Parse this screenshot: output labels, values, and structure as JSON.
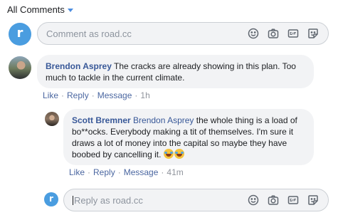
{
  "filter": {
    "label": "All Comments"
  },
  "composer": {
    "placeholder": "Comment as road.cc",
    "avatar_letter": "r"
  },
  "comments": [
    {
      "author": "Brendon Asprey",
      "text": "The cracks are already showing in this plan. Too much to tackle in the current climate.",
      "actions": {
        "like": "Like",
        "reply": "Reply",
        "message": "Message",
        "time": "1h"
      }
    },
    {
      "author": "Scott Bremner",
      "mention": "Brendon Asprey",
      "text": "the whole thing is a load of bo**ocks. Everybody making a tit of themselves. I'm sure it draws a lot of money into the capital so maybe they have boobed by cancelling it.",
      "actions": {
        "like": "Like",
        "reply": "Reply",
        "message": "Message",
        "time": "41m"
      }
    }
  ],
  "reply_composer": {
    "placeholder": "Reply as road.cc",
    "avatar_letter": "r"
  },
  "icons": [
    "smiley-icon",
    "camera-icon",
    "gif-icon",
    "sticker-icon"
  ],
  "colors": {
    "brand": "#4a9de0",
    "link": "#385898",
    "bubble": "#f2f3f5"
  }
}
